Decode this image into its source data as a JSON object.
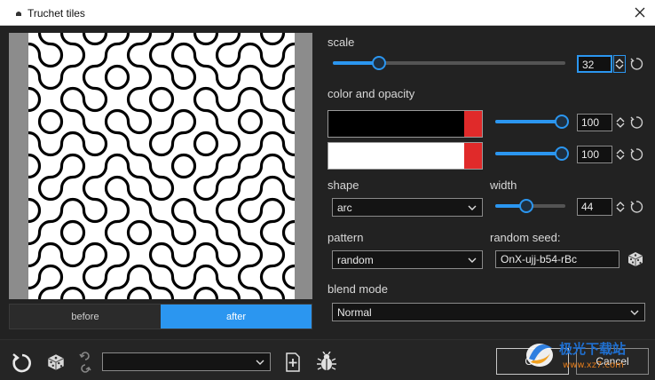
{
  "window": {
    "title": "Truchet tiles",
    "close_icon": "close-icon"
  },
  "preview": {
    "toggle": {
      "before": "before",
      "after": "after",
      "selected": "after"
    }
  },
  "scale": {
    "label": "scale",
    "value": "32",
    "slider_fraction": 0.2
  },
  "color_opacity": {
    "label": "color and opacity",
    "color1": {
      "color": "#000000",
      "opacity": "100",
      "slider_fraction": 1.0
    },
    "color2": {
      "color": "#ffffff",
      "opacity": "100",
      "slider_fraction": 1.0
    }
  },
  "shape": {
    "label": "shape",
    "value": "arc"
  },
  "width": {
    "label": "width",
    "value": "44",
    "slider_fraction": 0.44
  },
  "pattern": {
    "label": "pattern",
    "value": "random"
  },
  "random_seed": {
    "label": "random seed:",
    "value": "OnX-ujj-b54-rBc"
  },
  "blend_mode": {
    "label": "blend mode",
    "value": "Normal"
  },
  "footer": {
    "preset_value": "",
    "ok_label": "OK",
    "cancel_label": "Cancel"
  },
  "watermark": {
    "text": "极光下载站",
    "url": "www.xz7.com"
  },
  "accent_color": "#2b96f0"
}
